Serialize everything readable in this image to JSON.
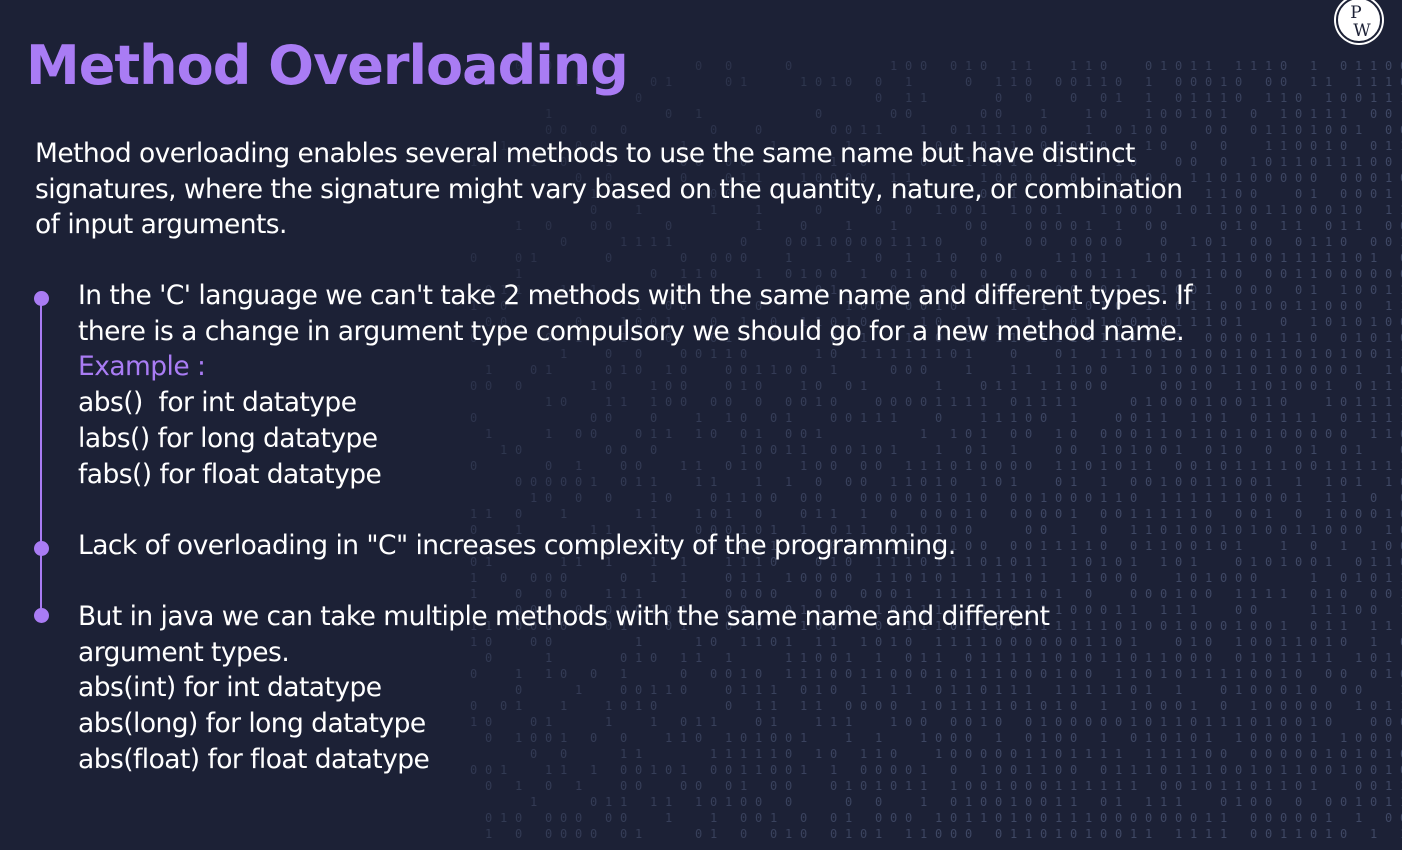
{
  "slide": {
    "title": "Method Overloading",
    "intro_lines": [
      "Method overloading enables several methods to use the same name but have distinct",
      "signatures, where the signature might vary based on the quantity, nature, or combination",
      "of input arguments."
    ],
    "bullets": [
      {
        "lines": [
          "In the 'C' language we can't take 2 methods with the same name and different types. If",
          "there is a change in argument type compulsory we should go for a new method name."
        ],
        "example_label": "Example :",
        "examples": [
          "abs()  for int datatype",
          "labs() for long datatype",
          "fabs() for float datatype"
        ]
      },
      {
        "lines": [
          "Lack of overloading in \"C\" increases complexity of the programming."
        ]
      },
      {
        "lines": [
          "But in java we can take multiple methods with the same name and different",
          "argument types."
        ],
        "examples": [
          "abs(int) for int datatype",
          "abs(long) for long datatype",
          "abs(float) for float datatype"
        ]
      }
    ]
  },
  "logo": {
    "letters": "PW"
  },
  "colors": {
    "background": "#1c2136",
    "accent": "#a97cf4",
    "text": "#ffffff",
    "binary": "#5a6688"
  }
}
